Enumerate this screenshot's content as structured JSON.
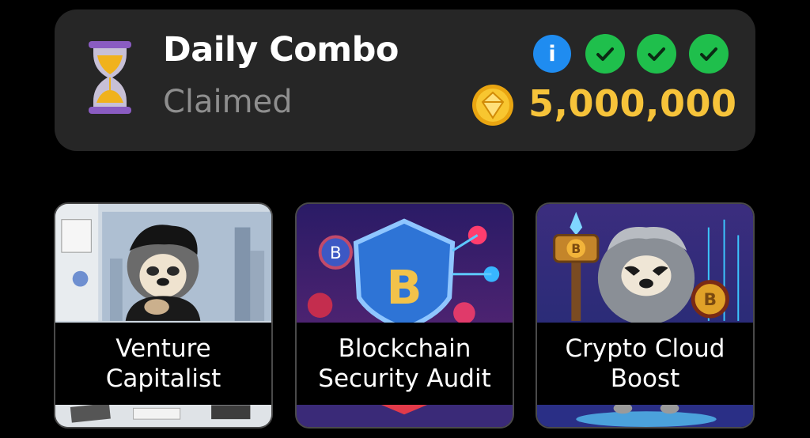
{
  "daily_combo": {
    "title": "Daily Combo",
    "status": "Claimed",
    "reward": "5,000,000",
    "info_icon": "i",
    "progress_checks": 3,
    "icons": {
      "hourglass": "hourglass-icon",
      "info": "info-icon",
      "check": "check-circle-icon",
      "coin": "coin-icon"
    },
    "colors": {
      "panel": "#262626",
      "info": "#1f8cf0",
      "check": "#1fbf4c",
      "reward": "#f6c33a"
    }
  },
  "cards": [
    {
      "title": "Venture\nCapitalist"
    },
    {
      "title": "Blockchain\nSecurity Audit"
    },
    {
      "title": "Crypto Cloud\nBoost"
    }
  ]
}
